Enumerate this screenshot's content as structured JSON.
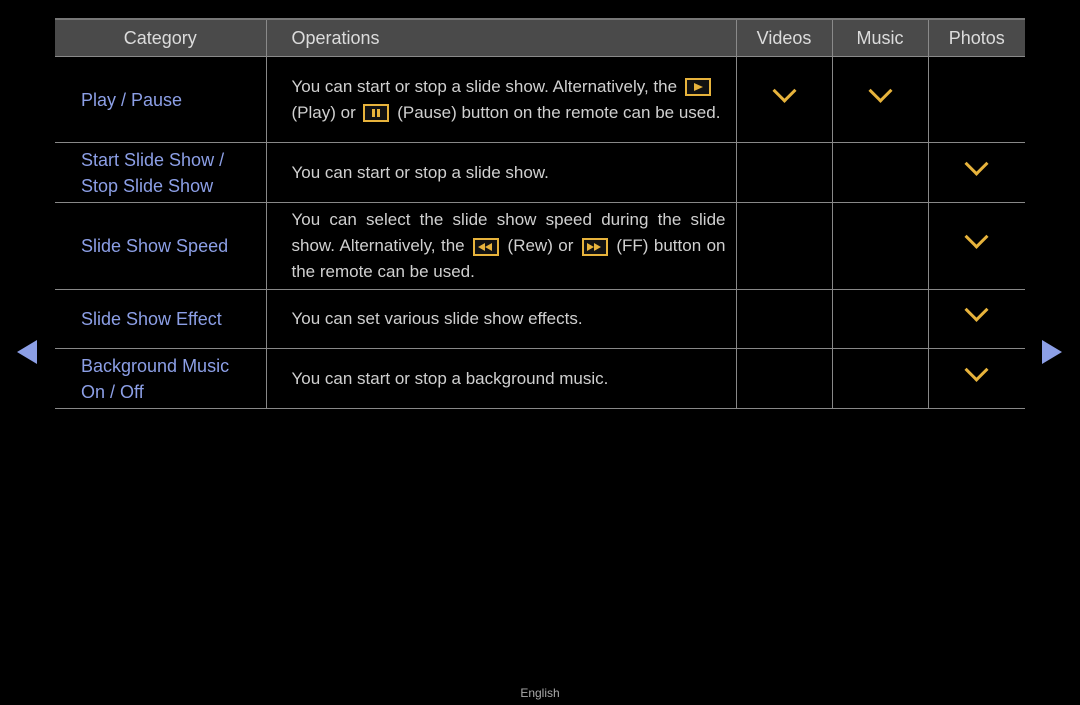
{
  "table": {
    "headers": [
      "Category",
      "Operations",
      "Videos",
      "Music",
      "Photos"
    ],
    "rows": [
      {
        "category": "Play / Pause",
        "ops": {
          "pre": "You can start or stop a slide show. Alternatively, the",
          "icon1": "play-button-icon",
          "mid": "(Play) or",
          "icon2": "pause-button-icon",
          "post": "(Pause) button on the remote can be used."
        },
        "videos": true,
        "music": true,
        "photos": false
      },
      {
        "category": "Start Slide Show / Stop Slide Show",
        "ops": {
          "text": "You can start or stop a slide show."
        },
        "videos": false,
        "music": false,
        "photos": true
      },
      {
        "category": "Slide Show Speed",
        "ops": {
          "pre": "You can select the slide show speed during the slide show. Alternatively, the",
          "icon1": "rewind-button-icon",
          "mid": "(Rew) or",
          "icon2": "fast-forward-button-icon",
          "post": "(FF) button on the remote can be used."
        },
        "videos": false,
        "music": false,
        "photos": true
      },
      {
        "category": "Slide Show Effect",
        "ops": {
          "text": "You can set various slide show effects."
        },
        "videos": false,
        "music": false,
        "photos": true
      },
      {
        "category": "Background Music On / Off",
        "ops": {
          "text": "You can start or stop a background music."
        },
        "videos": false,
        "music": false,
        "photos": true
      }
    ]
  },
  "navigation": {
    "prev": "previous-page-icon",
    "next": "next-page-icon"
  },
  "footer": {
    "language": "English"
  },
  "colors": {
    "accent": "#8c9fe6",
    "check": "#e7b33c",
    "header_bg": "#4a4a4a"
  }
}
